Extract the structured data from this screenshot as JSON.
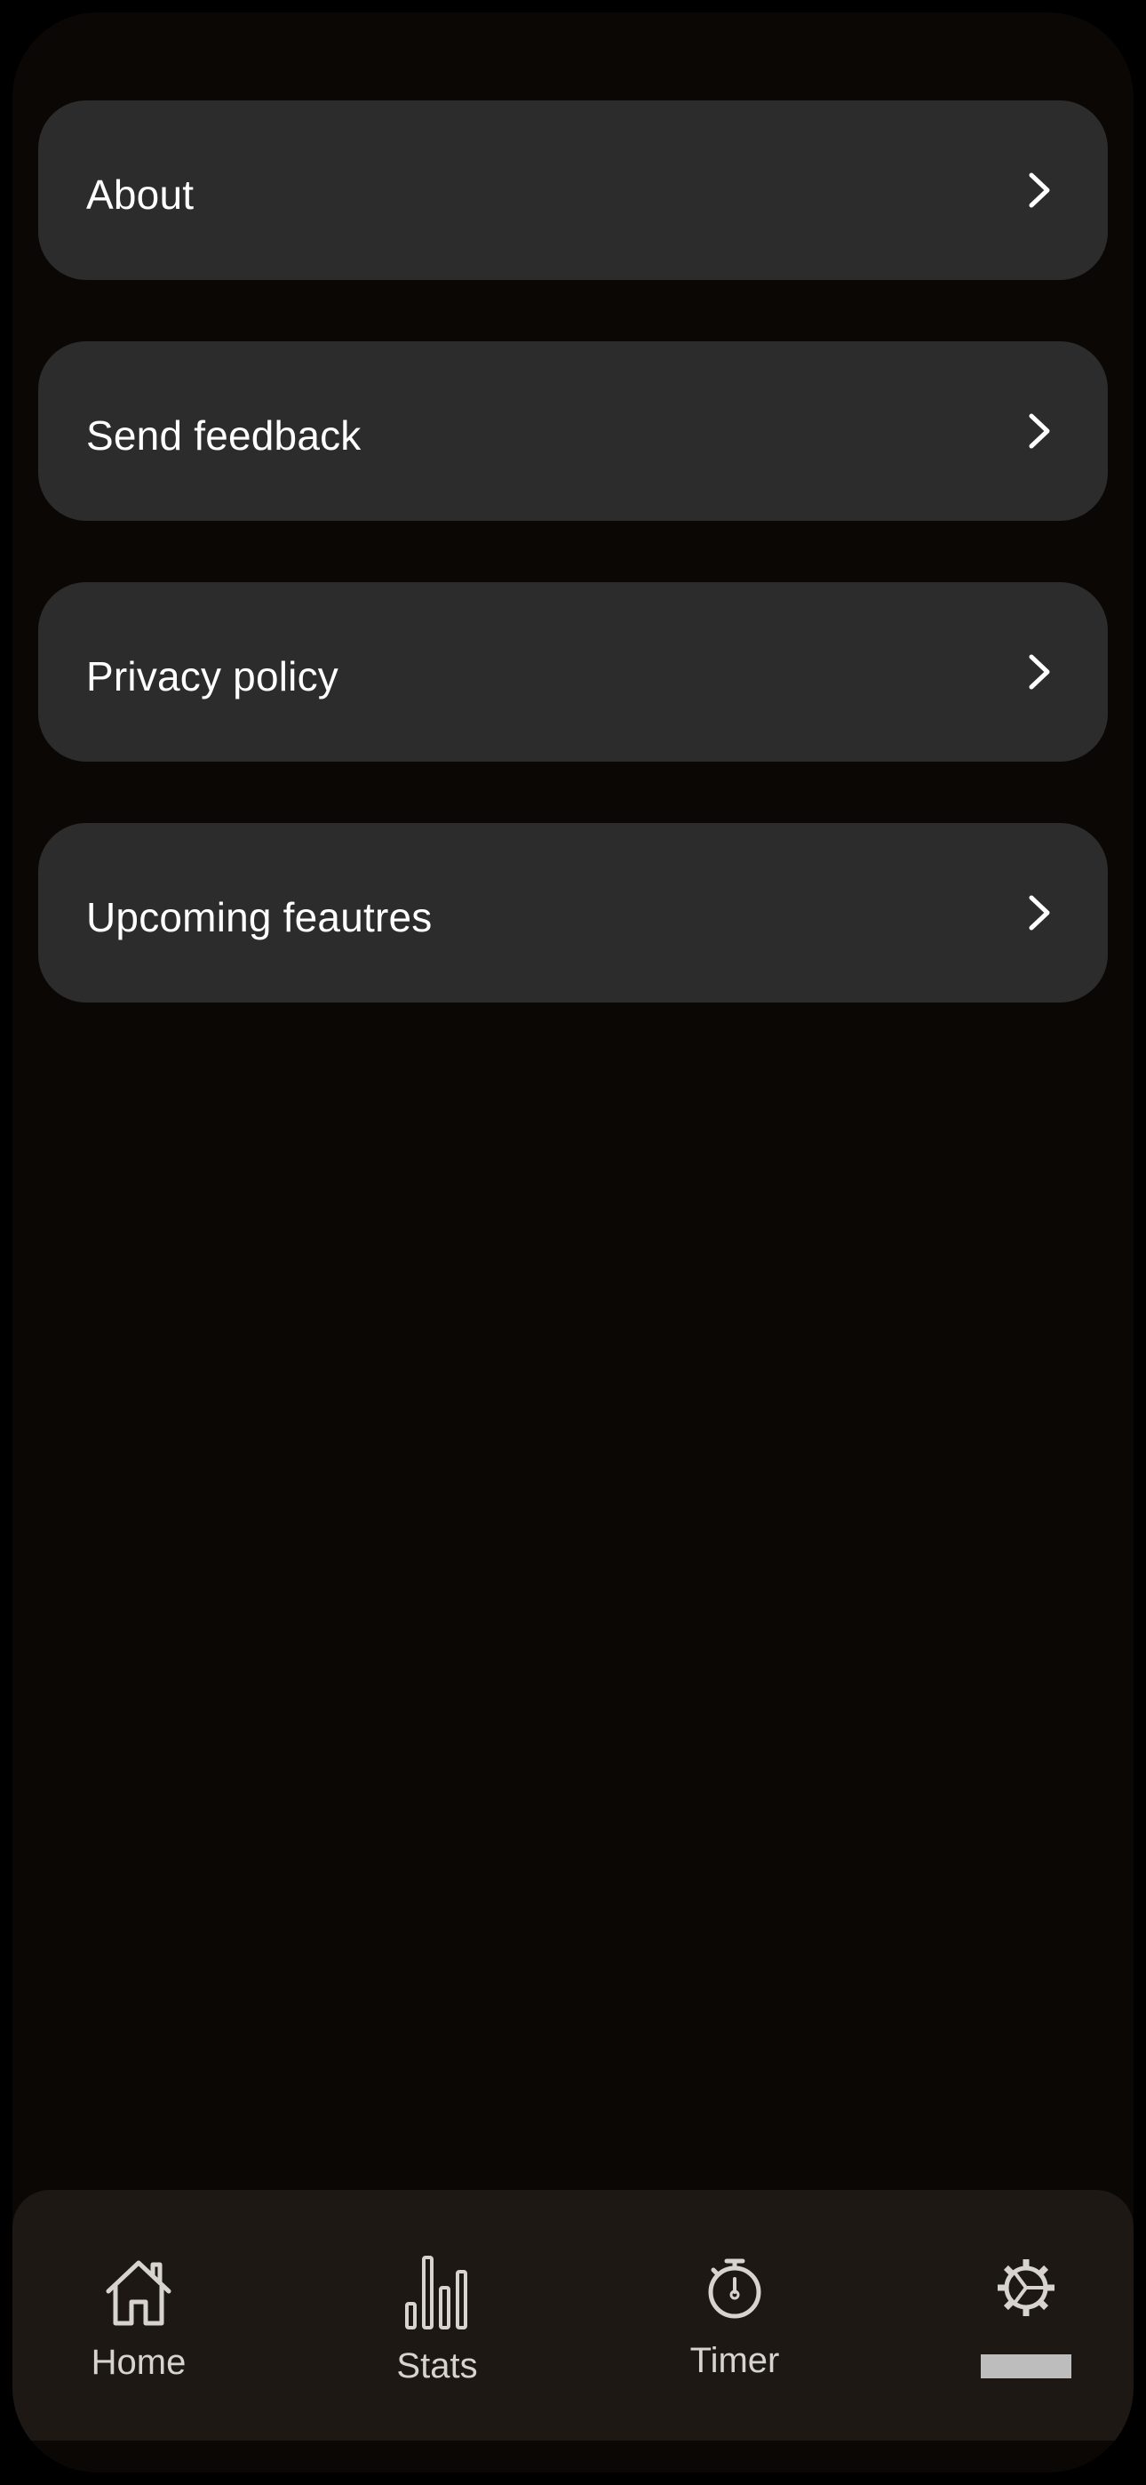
{
  "menu": {
    "items": [
      {
        "label": "About"
      },
      {
        "label": "Send feedback"
      },
      {
        "label": "Privacy policy"
      },
      {
        "label": "Upcoming feautres"
      }
    ]
  },
  "tabbar": {
    "tabs": [
      {
        "label": "Home",
        "icon": "home-icon"
      },
      {
        "label": "Stats",
        "icon": "bar-chart-icon"
      },
      {
        "label": "Timer",
        "icon": "stopwatch-icon"
      },
      {
        "label": "",
        "icon": "gear-icon",
        "active": true
      }
    ]
  },
  "colors": {
    "background": "#0b0705",
    "card": "#2c2c2c",
    "tabbar": "#1e1814",
    "text": "#ffffff",
    "tab_text": "#d7d3cf",
    "indicator": "#bdbdbd"
  }
}
